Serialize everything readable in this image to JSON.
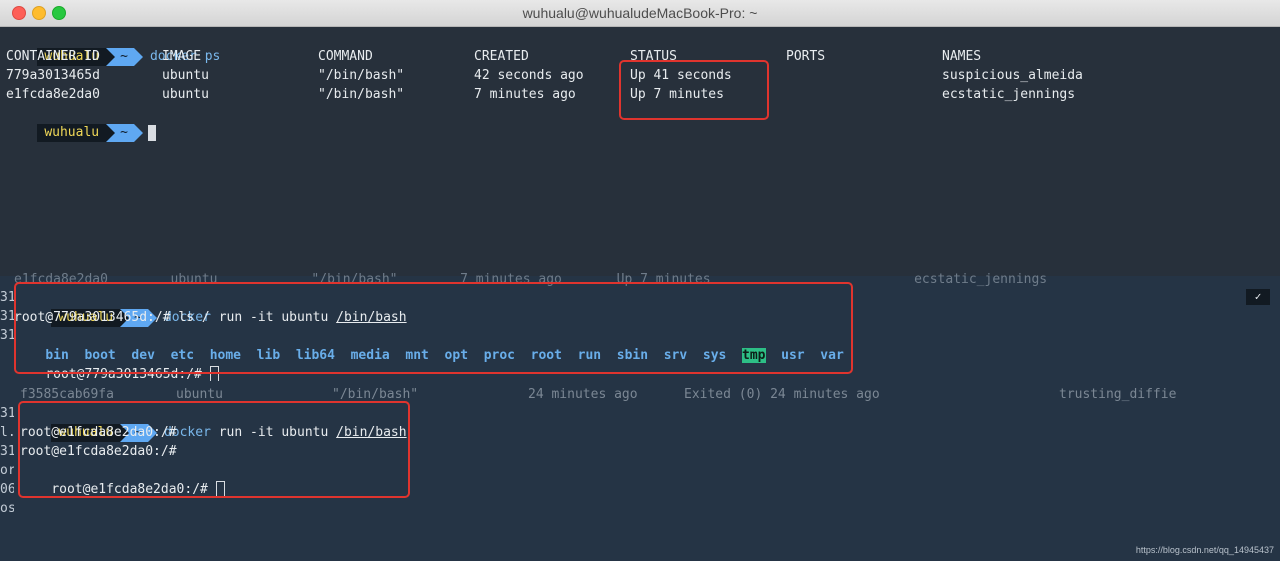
{
  "window": {
    "title": "wuhualu@wuhualudeMacBook-Pro: ~"
  },
  "prompt": {
    "user": "wuhualu",
    "dir": "~"
  },
  "top_pane": {
    "command": "docker ps",
    "headers": [
      "CONTAINER ID",
      "IMAGE",
      "COMMAND",
      "CREATED",
      "STATUS",
      "PORTS",
      "NAMES"
    ],
    "rows": [
      [
        "779a3013465d",
        "ubuntu",
        "\"/bin/bash\"",
        "42 seconds ago",
        "Up 41 seconds",
        "",
        "suspicious_almeida"
      ],
      [
        "e1fcda8e2da0",
        "ubuntu",
        "\"/bin/bash\"",
        "7 minutes ago",
        "Up 7 minutes",
        "",
        "ecstatic_jennings"
      ]
    ]
  },
  "mid_pane": {
    "ghost_line": "e1fcda8e2da0        ubuntu            \"/bin/bash\"        7 minutes ago       Up 7 minutes                          ecstatic_jennings",
    "cmd_word": "docker",
    "cmd_args": " run -it ubuntu ",
    "cmd_path": "/bin/bash",
    "ls_prompt": "root@779a3013465d:/# ls /",
    "dirs": [
      "bin",
      "boot",
      "dev",
      "etc",
      "home",
      "lib",
      "lib64",
      "media",
      "mnt",
      "opt",
      "proc",
      "root",
      "run",
      "sbin",
      "srv",
      "sys",
      "tmp",
      "usr",
      "var"
    ],
    "last_prompt": "root@779a3013465d:/# ",
    "gutter": [
      "31",
      "31",
      "31"
    ],
    "check": "✓"
  },
  "bot_pane": {
    "ghost": {
      "id": "f3585cab69fa",
      "image": "ubuntu",
      "command": "\"/bin/bash\"",
      "created": "24 minutes ago",
      "status": "Exited (0) 24 minutes ago",
      "name": "trusting_diffie"
    },
    "cmd_word": "docker",
    "cmd_args": " run -it ubuntu ",
    "cmd_path": "/bin/bash",
    "lines": [
      "root@e1fcda8e2da0:/#",
      "root@e1fcda8e2da0:/#",
      "root@e1fcda8e2da0:/# "
    ],
    "gutter": [
      "31",
      "l.",
      "31",
      "or",
      "06",
      "os"
    ]
  },
  "watermark": "https://blog.csdn.net/qq_14945437",
  "colors": {
    "highlight_box": "#e0342e",
    "prompt_user_bg": "#121a22",
    "prompt_dir_bg": "#5fa8f2"
  }
}
